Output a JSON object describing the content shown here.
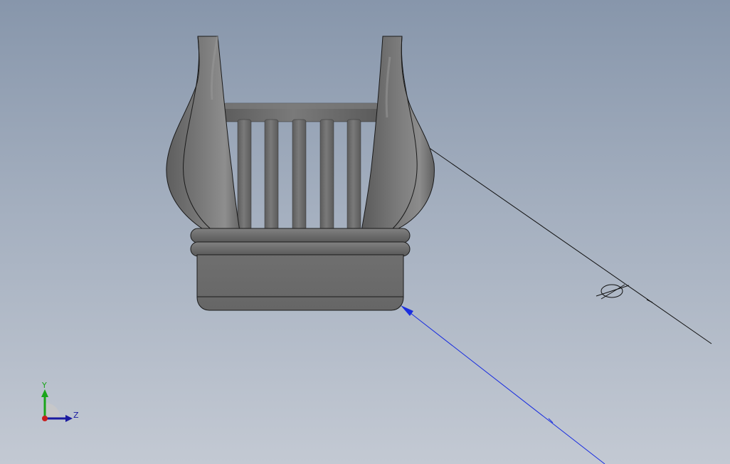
{
  "viewport": {
    "background_top": "#8796ab",
    "background_bottom": "#c3c9d3"
  },
  "model": {
    "body_color": "#6e6e6e",
    "highlight_color": "#8a8a8a",
    "edge_color": "#1e1e1e"
  },
  "sketch_lines": {
    "black_line_color": "#111111",
    "blue_line_color": "#1a2ee0",
    "diameter_symbol": "phi-diameter-icon"
  },
  "triad": {
    "y_label": "Y",
    "z_label": "Z",
    "y_color": "#1aa51a",
    "z_color": "#1a1aa0",
    "origin_color": "#c81e1e"
  }
}
